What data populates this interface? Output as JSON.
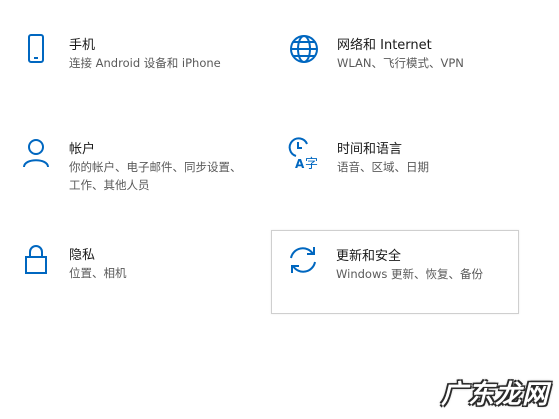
{
  "accent_color": "#0067c0",
  "tiles": [
    {
      "title": "手机",
      "desc": "连接 Android 设备和 iPhone",
      "icon": "phone-icon"
    },
    {
      "title": "网络和 Internet",
      "desc": "WLAN、飞行模式、VPN",
      "icon": "globe-icon"
    },
    {
      "title": "帐户",
      "desc": "你的帐户、电子邮件、同步设置、工作、其他人员",
      "icon": "person-icon"
    },
    {
      "title": "时间和语言",
      "desc": "语音、区域、日期",
      "icon": "time-language-icon"
    },
    {
      "title": "隐私",
      "desc": "位置、相机",
      "icon": "lock-icon"
    },
    {
      "title": "更新和安全",
      "desc": "Windows 更新、恢复、备份",
      "icon": "sync-icon"
    }
  ],
  "watermark": "广东龙网"
}
